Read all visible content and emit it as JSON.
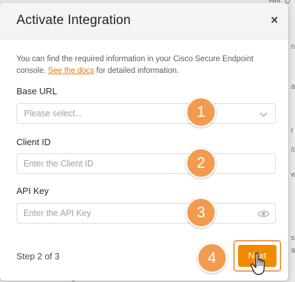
{
  "background": {
    "fragments": [
      "Her. D",
      "n",
      "a",
      "r",
      "/c",
      "w",
      "s",
      "a",
      "g"
    ]
  },
  "modal": {
    "title": "Activate Integration",
    "close_icon": "×",
    "intro_text": "You can find the required information in your Cisco Secure Endpoint console.",
    "intro_link": "See the docs",
    "intro_suffix": "for detailed information."
  },
  "fields": {
    "base_url": {
      "label": "Base URL",
      "placeholder": "Please select..."
    },
    "client_id": {
      "label": "Client ID",
      "placeholder": "Enter the Client ID"
    },
    "api_key": {
      "label": "API Key",
      "placeholder": "Enter the API Key"
    }
  },
  "badges": [
    "1",
    "2",
    "3",
    "4"
  ],
  "footer": {
    "step_text": "Step 2 of 3",
    "next_label": "Next"
  },
  "colors": {
    "accent": "#f08a00",
    "badge": "#f29b4f",
    "link": "#e07b12"
  },
  "icons": {
    "close": "close-icon",
    "chevron": "chevron-down-icon",
    "eye": "eye-icon",
    "cursor": "hand-pointer-icon"
  }
}
